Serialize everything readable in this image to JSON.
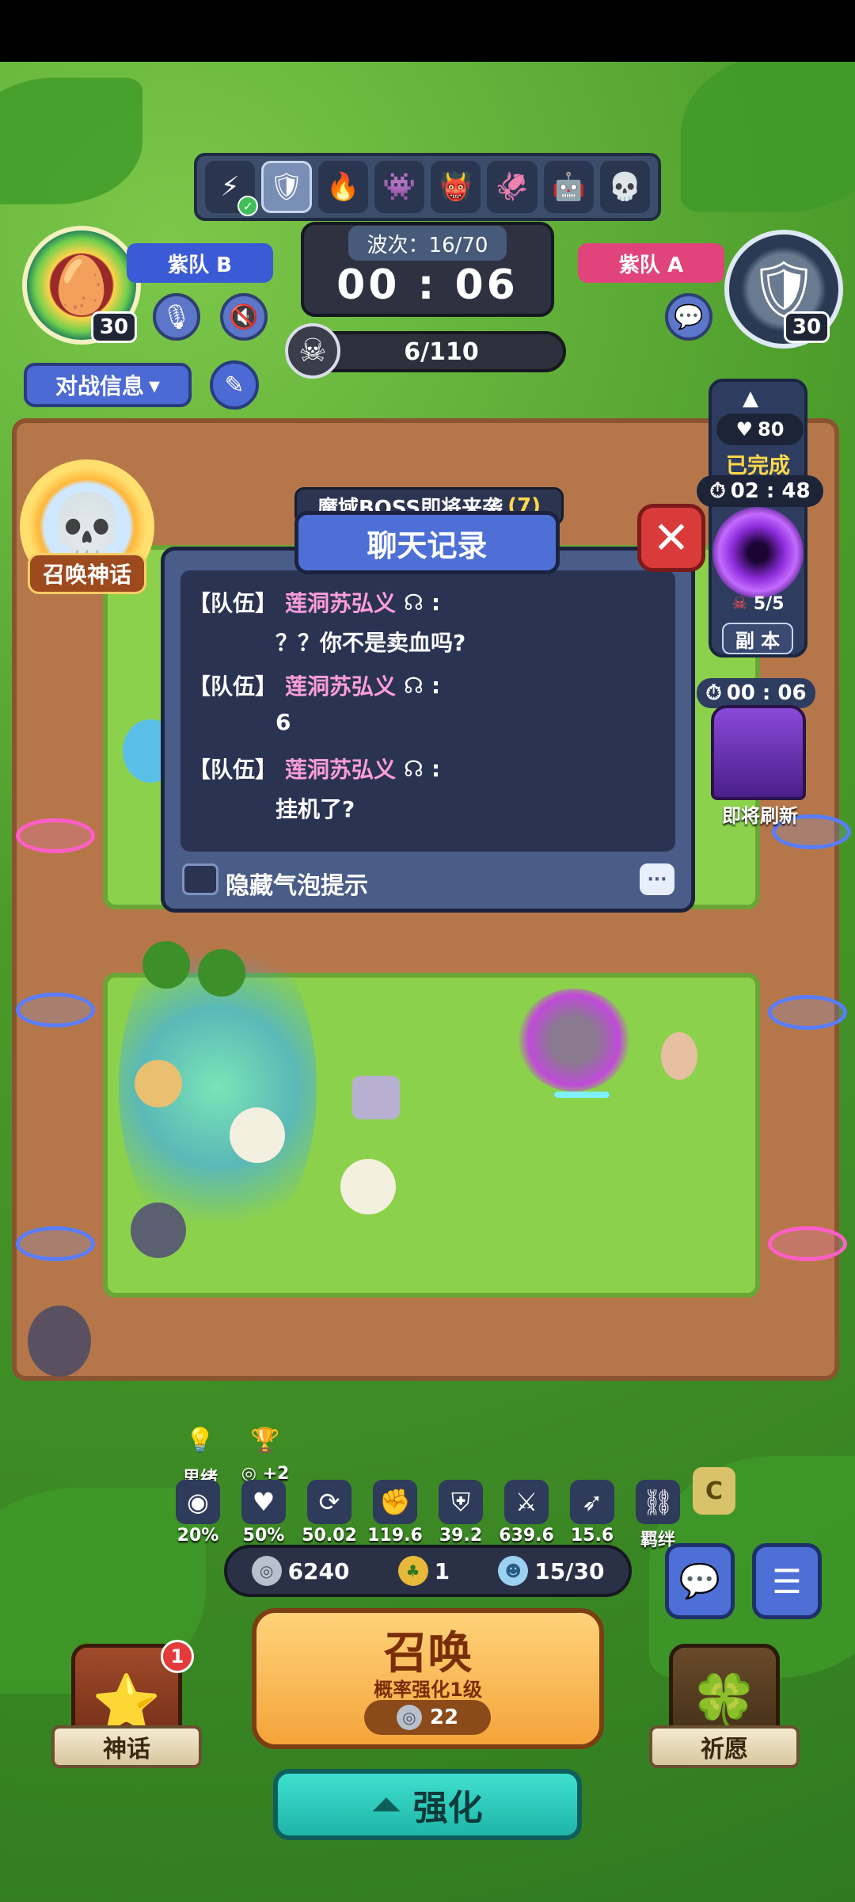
{
  "top": {
    "hero_strip": [
      "⚡",
      "🛡",
      "🔥",
      "👾",
      "👹",
      "🦑",
      "🤖",
      "💀"
    ],
    "team_left": {
      "name": "紫队 B",
      "level": "30"
    },
    "team_right": {
      "name": "紫队 A",
      "level": "30"
    },
    "wave_label": "波次：16/70",
    "timer": "00 : 06",
    "kills": "6/110",
    "battle_info": "对战信息"
  },
  "left": {
    "summon_myth": "召唤神话"
  },
  "boss_banner": {
    "text": "魔域BOSS即将来袭",
    "count": "(7)"
  },
  "dungeon": {
    "hearts": "80",
    "status": "已完成",
    "time": "02 : 48",
    "count": "5/5",
    "label": "副 本",
    "refresh_time": "00 : 06",
    "refresh_label": "即将刷新"
  },
  "chat": {
    "title": "聊天记录",
    "messages": [
      {
        "tag": "【队伍】",
        "name": "莲洞苏弘义",
        "text": "？？你不是卖血吗?"
      },
      {
        "tag": "【队伍】",
        "name": "莲洞苏弘义",
        "text": "6"
      },
      {
        "tag": "【队伍】",
        "name": "莲洞苏弘义",
        "text": "挂机了?"
      }
    ],
    "hide_bubbles": "隐藏气泡提示"
  },
  "stats": {
    "upper": [
      {
        "label": "思绪"
      },
      {
        "label": "+2"
      }
    ],
    "row": [
      {
        "icon": "target-icon",
        "value": "20%"
      },
      {
        "icon": "heart-icon",
        "value": "50%"
      },
      {
        "icon": "speed-icon",
        "value": "50.02"
      },
      {
        "icon": "fist-icon",
        "value": "119.6"
      },
      {
        "icon": "shield-icon",
        "value": "39.2"
      },
      {
        "icon": "sword-icon",
        "value": "639.6"
      },
      {
        "icon": "arrow-icon",
        "value": "15.6"
      },
      {
        "icon": "chain-icon",
        "value": "羁绊"
      }
    ]
  },
  "resources": {
    "silver": "6240",
    "clover": "1",
    "population": "15/30"
  },
  "summon": {
    "title": "召唤",
    "subtitle": "概率强化1级",
    "cost": "22"
  },
  "upgrade": {
    "label": "强化"
  },
  "myth": {
    "label": "神话",
    "badge": "1"
  },
  "wish": {
    "label": "祈愿"
  }
}
